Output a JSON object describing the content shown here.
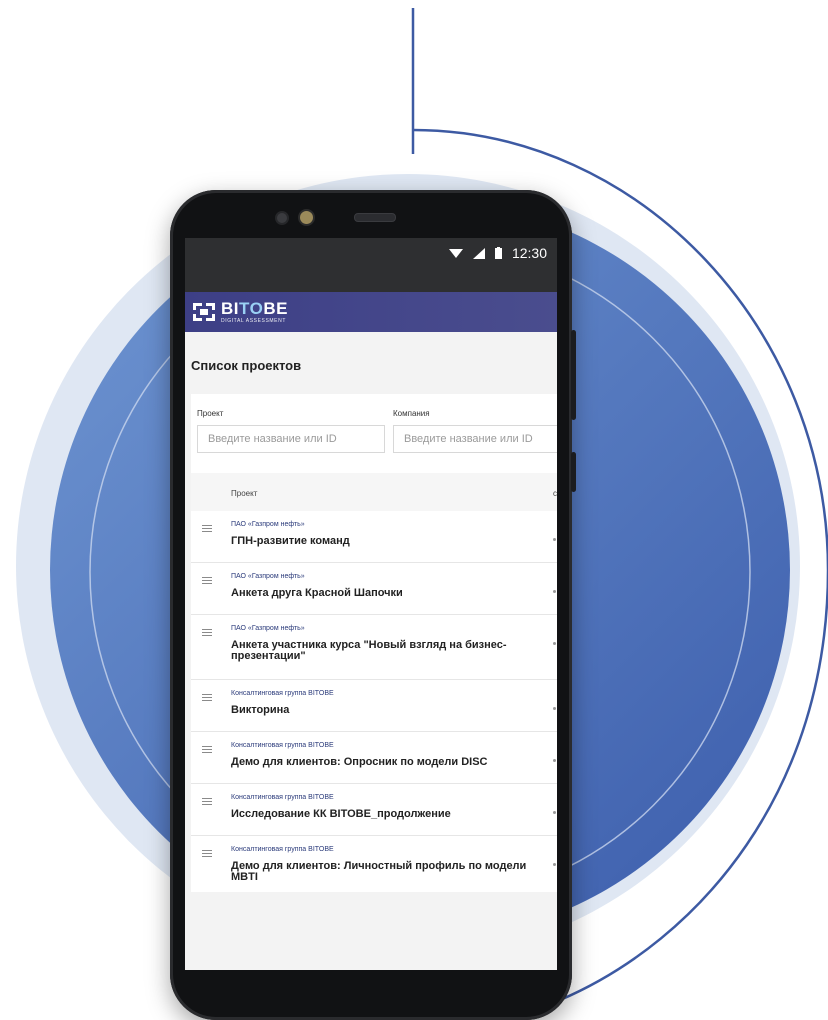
{
  "status_bar": {
    "time": "12:30",
    "icons": [
      "wifi-icon",
      "signal-icon",
      "battery-icon"
    ]
  },
  "app": {
    "brand_part1": "BI",
    "brand_part2": "TO",
    "brand_part3": "BE",
    "brand_sub": "DIGITAL ASSESSMENT",
    "accent": "#3d3f86"
  },
  "page": {
    "title": "Список проектов"
  },
  "filters": {
    "project_label": "Проект",
    "project_placeholder": "Введите название или ID",
    "company_label": "Компания",
    "company_placeholder": "Введите название или ID"
  },
  "table": {
    "column_project": "Проект",
    "column_second": "с",
    "rows": [
      {
        "company": "ПАО «Газпром нефть»",
        "name": "ГПН-развитие команд"
      },
      {
        "company": "ПАО «Газпром нефть»",
        "name": "Анкета друга Красной Шапочки"
      },
      {
        "company": "ПАО «Газпром нефть»",
        "name": "Анкета участника курса \"Новый взгляд на бизнес-презентации\""
      },
      {
        "company": "Консалтинговая группа BITOBE",
        "name": "Викторина"
      },
      {
        "company": "Консалтинговая группа BITOBE",
        "name": "Демо для клиентов: Опросник по модели DISC"
      },
      {
        "company": "Консалтинговая группа BITOBE",
        "name": "Исследование КК BITOBE_продолжение"
      },
      {
        "company": "Консалтинговая группа BITOBE",
        "name": "Демо для клиентов: Личностный профиль по модели MBTI"
      }
    ]
  }
}
